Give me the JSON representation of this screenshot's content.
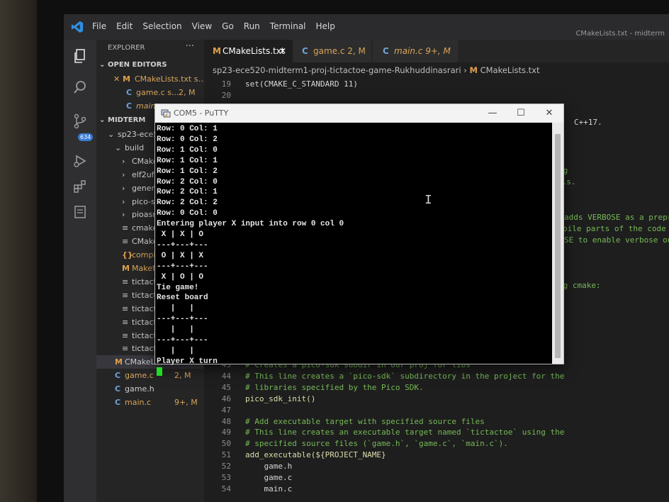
{
  "titlebar": {
    "menu": [
      "File",
      "Edit",
      "Selection",
      "View",
      "Go",
      "Run",
      "Terminal",
      "Help"
    ],
    "window_title": "CMakeLists.txt - midterm"
  },
  "activity": {
    "badge": "634",
    "icons": [
      "files-icon",
      "search-icon",
      "source-control-icon",
      "run-debug-icon",
      "extensions-icon",
      "remote-icon"
    ]
  },
  "sidebar": {
    "header": "EXPLORER",
    "more": "···",
    "open_editors_label": "OPEN EDITORS",
    "open_editors": [
      {
        "mark": "✕ M",
        "name": "CMakeLists.txt s...",
        "status": ""
      },
      {
        "mark": "C",
        "name": "game.c s...",
        "status": "2, M"
      },
      {
        "mark": "C",
        "name": "main",
        "status": ""
      }
    ],
    "folder_label": "MIDTERM",
    "tree": [
      {
        "glyph": "⌄",
        "name": "sp23-ece5",
        "kind": "folder",
        "indent": 1
      },
      {
        "glyph": "⌄",
        "name": "build",
        "kind": "folder",
        "indent": 2
      },
      {
        "glyph": "›",
        "name": "CMake",
        "kind": "folder",
        "indent": 3
      },
      {
        "glyph": "›",
        "name": "elf2uf2",
        "kind": "folder",
        "indent": 3
      },
      {
        "glyph": "›",
        "name": "genera",
        "kind": "folder",
        "indent": 3
      },
      {
        "glyph": "›",
        "name": "pico-sc",
        "kind": "folder",
        "indent": 3
      },
      {
        "glyph": "›",
        "name": "pioasm",
        "kind": "folder",
        "indent": 3
      },
      {
        "glyph": "≡",
        "name": "cmake",
        "kind": "lines",
        "indent": 3
      },
      {
        "glyph": "≡",
        "name": "CMake",
        "kind": "lines",
        "indent": 3
      },
      {
        "glyph": "{}",
        "name": "compil",
        "kind": "json",
        "indent": 3
      },
      {
        "glyph": "M",
        "name": "Makefi",
        "kind": "make",
        "indent": 3
      },
      {
        "glyph": "≡",
        "name": "tictacto",
        "kind": "lines",
        "indent": 3
      },
      {
        "glyph": "≡",
        "name": "tictacto",
        "kind": "lines",
        "indent": 3
      },
      {
        "glyph": "≡",
        "name": "tictacto",
        "kind": "lines",
        "indent": 3
      },
      {
        "glyph": "≡",
        "name": "tictacto",
        "kind": "lines",
        "indent": 3
      },
      {
        "glyph": "≡",
        "name": "tictacto",
        "kind": "lines",
        "indent": 3
      },
      {
        "glyph": "≡",
        "name": "tictacto",
        "kind": "lines",
        "indent": 3
      },
      {
        "glyph": "M",
        "name": "CMakeLists.txt",
        "kind": "cmake",
        "indent": 2,
        "status": ""
      },
      {
        "glyph": "C",
        "name": "game.c",
        "kind": "c",
        "indent": 2,
        "status": "2, M"
      },
      {
        "glyph": "C",
        "name": "game.h",
        "kind": "c",
        "indent": 2,
        "status": ""
      },
      {
        "glyph": "C",
        "name": "main.c",
        "kind": "c",
        "indent": 2,
        "status": "9+, M"
      }
    ]
  },
  "tabs": [
    {
      "icon": "M",
      "label": "CMakeLists.txt",
      "close": "✕",
      "active": true
    },
    {
      "icon": "C",
      "label": "game.c 2, M",
      "close": "",
      "active": false
    },
    {
      "icon": "C",
      "label": "main.c 9+, M",
      "close": "",
      "active": false
    }
  ],
  "breadcrumb": [
    "sp23-ece520-midterm1-proj-tictactoe-game-Rukhuddinasrari",
    "M",
    "CMakeLists.txt"
  ],
  "editor": {
    "top_lines": [
      {
        "n": "19",
        "text": "set(CMAKE_C_STANDARD 11)"
      },
      {
        "n": "20",
        "text": ""
      }
    ],
    "visible_tails": [
      {
        "text": "C++17."
      },
      {
        "text": "ng"
      },
      {
        "text": "ols."
      },
      {
        "text": "adds VERBOSE as a prepr"
      },
      {
        "text": "pile parts of the code b"
      },
      {
        "text": "SE to enable verbose out"
      },
      {
        "text": "ng cmake:"
      }
    ],
    "lines": [
      {
        "n": "43",
        "text": "# Creates a pico-sdk subdir in our proj for libs",
        "kind": "comment"
      },
      {
        "n": "44",
        "text": "# This line creates a `pico-sdk` subdirectory in the project for the",
        "kind": "comment"
      },
      {
        "n": "45",
        "text": "# libraries specified by the Pico SDK.",
        "kind": "comment"
      },
      {
        "n": "46",
        "text": "pico_sdk_init()",
        "kind": "fn"
      },
      {
        "n": "47",
        "text": "",
        "kind": "plain"
      },
      {
        "n": "48",
        "text": "# Add executable target with specified source files",
        "kind": "comment"
      },
      {
        "n": "49",
        "text": "# This line creates an executable target named `tictactoe` using the",
        "kind": "comment"
      },
      {
        "n": "50",
        "text": "# specified source files (`game.h`, `game.c`, `main.c`).",
        "kind": "comment"
      },
      {
        "n": "51",
        "text": "add_executable(${PROJECT_NAME}",
        "kind": "fnvar"
      },
      {
        "n": "52",
        "text": "    game.h",
        "kind": "plain"
      },
      {
        "n": "53",
        "text": "    game.c",
        "kind": "plain"
      },
      {
        "n": "54",
        "text": "    main.c",
        "kind": "plain"
      }
    ]
  },
  "putty": {
    "title": "COM5 - PuTTY",
    "buttons": {
      "minimize": "—",
      "maximize": "☐",
      "close": "✕"
    },
    "lines": [
      "Row: 0 Col: 1",
      "Row: 0 Col: 2",
      "Row: 1 Col: 0",
      "Row: 1 Col: 1",
      "Row: 1 Col: 2",
      "Row: 2 Col: 0",
      "Row: 2 Col: 1",
      "Row: 2 Col: 2",
      "Row: 0 Col: 0",
      "Entering player X input into row 0 col 0",
      " X | X | O",
      "---+---+---",
      " O | X | X",
      "---+---+---",
      " X | O | O",
      "Tie game!",
      "Reset board",
      "   |   |",
      "---+---+---",
      "   |   |",
      "---+---+---",
      "   |   |",
      "Player X turn"
    ]
  }
}
